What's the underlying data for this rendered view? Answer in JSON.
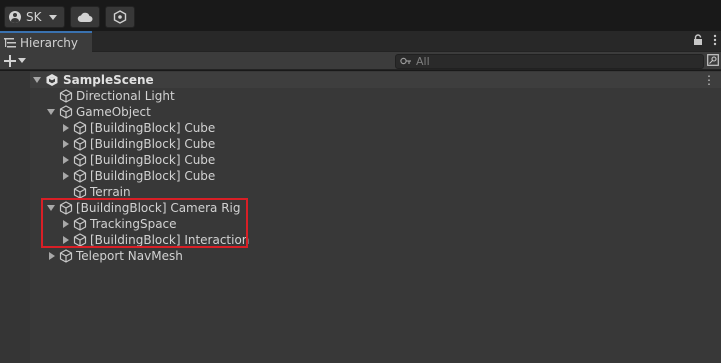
{
  "toolbar": {
    "account_label": "SK"
  },
  "panel": {
    "tab_label": "Hierarchy"
  },
  "search": {
    "placeholder": "All"
  },
  "scene": {
    "name": "SampleScene"
  },
  "tree": [
    {
      "label": "Directional Light"
    },
    {
      "label": "GameObject"
    },
    {
      "label": "[BuildingBlock] Cube"
    },
    {
      "label": "[BuildingBlock] Cube"
    },
    {
      "label": "[BuildingBlock] Cube"
    },
    {
      "label": "[BuildingBlock] Cube"
    },
    {
      "label": "Terrain"
    },
    {
      "label": "[BuildingBlock] Camera Rig"
    },
    {
      "label": "TrackingSpace"
    },
    {
      "label": "[BuildingBlock] Interaction"
    },
    {
      "label": "Teleport NavMesh"
    }
  ],
  "colors": {
    "highlight_border": "#d91f26",
    "tab_accent": "#3a72b0"
  }
}
